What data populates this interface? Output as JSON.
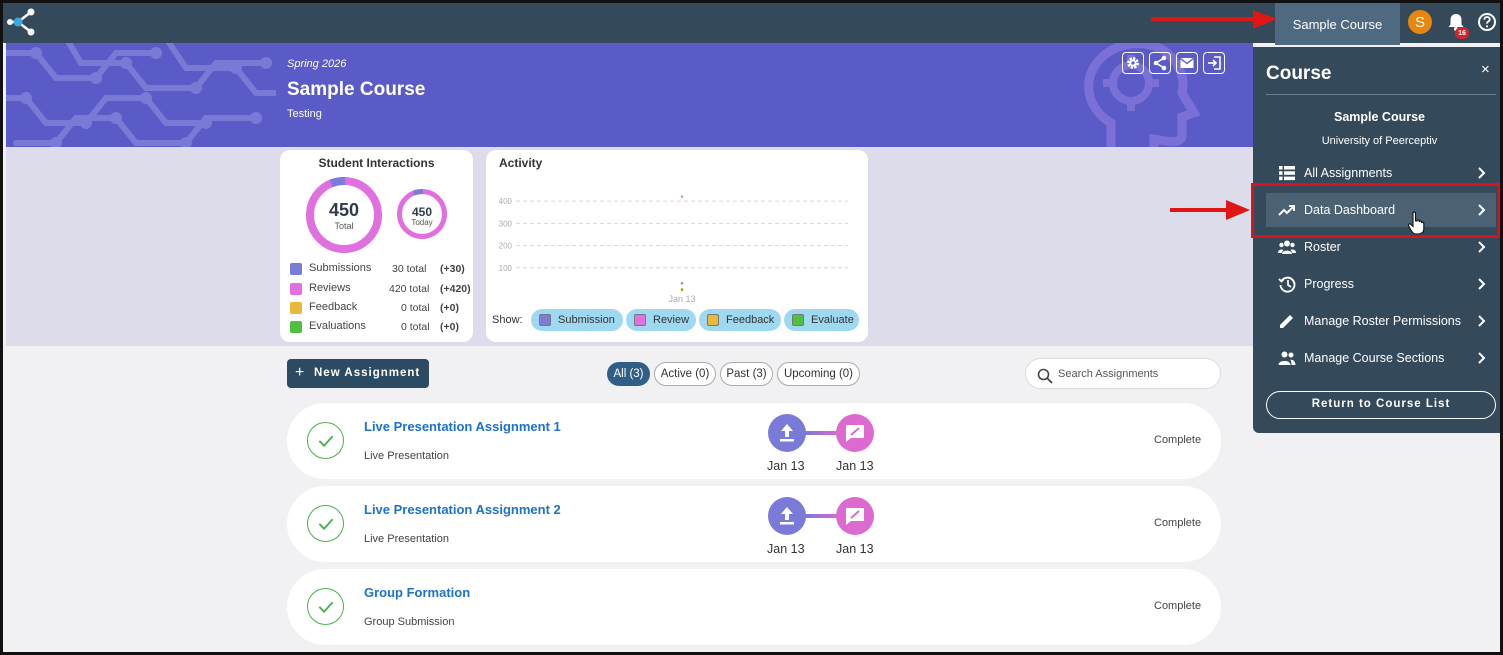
{
  "topbar": {
    "course_button": "Sample Course",
    "avatar_letter": "S",
    "notification_count": "16"
  },
  "banner": {
    "term": "Spring 2026",
    "title": "Sample Course",
    "subtitle": "Testing"
  },
  "interactions": {
    "title": "Student Interactions",
    "total_value": "450",
    "total_label": "Total",
    "today_value": "450",
    "today_label": "Today",
    "legend": [
      {
        "name": "Submissions",
        "total": "30 total",
        "delta": "(+30)",
        "color": "#7b7bd8"
      },
      {
        "name": "Reviews",
        "total": "420 total",
        "delta": "(+420)",
        "color": "#e06fe0"
      },
      {
        "name": "Feedback",
        "total": "0 total",
        "delta": "(+0)",
        "color": "#e8b93a"
      },
      {
        "name": "Evaluations",
        "total": "0 total",
        "delta": "(+0)",
        "color": "#4fc040"
      }
    ]
  },
  "activity": {
    "title": "Activity",
    "show_label": "Show:",
    "chips": [
      {
        "label": "Submission",
        "color": "#7b7bd8"
      },
      {
        "label": "Review",
        "color": "#e06fe0"
      },
      {
        "label": "Feedback",
        "color": "#e8b93a"
      },
      {
        "label": "Evaluate",
        "color": "#4fc040"
      }
    ]
  },
  "chart_data": {
    "type": "scatter",
    "title": "Activity",
    "categories": [
      "Jan 13"
    ],
    "y_ticks": [
      "400",
      "300",
      "200",
      "100"
    ],
    "ylim": [
      0,
      450
    ],
    "series": [
      {
        "name": "Submission",
        "values": [
          30
        ]
      },
      {
        "name": "Review",
        "values": [
          420
        ]
      },
      {
        "name": "Feedback",
        "values": [
          0
        ]
      },
      {
        "name": "Evaluate",
        "values": [
          0
        ]
      }
    ],
    "grid": true
  },
  "toolbar": {
    "new_assignment": "New Assignment",
    "filters": [
      {
        "label": "All (3)",
        "active": true
      },
      {
        "label": "Active (0)",
        "active": false
      },
      {
        "label": "Past (3)",
        "active": false
      },
      {
        "label": "Upcoming (0)",
        "active": false
      }
    ],
    "search_placeholder": "Search Assignments"
  },
  "assignments": [
    {
      "title": "Live Presentation Assignment 1",
      "type": "Live Presentation",
      "status": "Complete",
      "submit_date": "Jan 13",
      "review_date": "Jan 13"
    },
    {
      "title": "Live Presentation Assignment 2",
      "type": "Live Presentation",
      "status": "Complete",
      "submit_date": "Jan 13",
      "review_date": "Jan 13"
    },
    {
      "title": "Group Formation",
      "type": "Group Submission",
      "status": "Complete"
    }
  ],
  "panel": {
    "title": "Course",
    "close": "×",
    "course": "Sample Course",
    "school": "University of Peerceptiv",
    "items": [
      {
        "label": "All Assignments",
        "icon": "list-icon"
      },
      {
        "label": "Data Dashboard",
        "icon": "trending-up-icon"
      },
      {
        "label": "Roster",
        "icon": "people-icon"
      },
      {
        "label": "Progress",
        "icon": "history-icon"
      },
      {
        "label": "Manage Roster Permissions",
        "icon": "pencil-icon"
      },
      {
        "label": "Manage Course Sections",
        "icon": "group-icon"
      }
    ],
    "return_button": "Return to Course List"
  },
  "colors": {
    "topbar": "#34495a",
    "banner": "#5b5bc8",
    "accent_link": "#1d72c9",
    "highlight": "#d7131f"
  }
}
